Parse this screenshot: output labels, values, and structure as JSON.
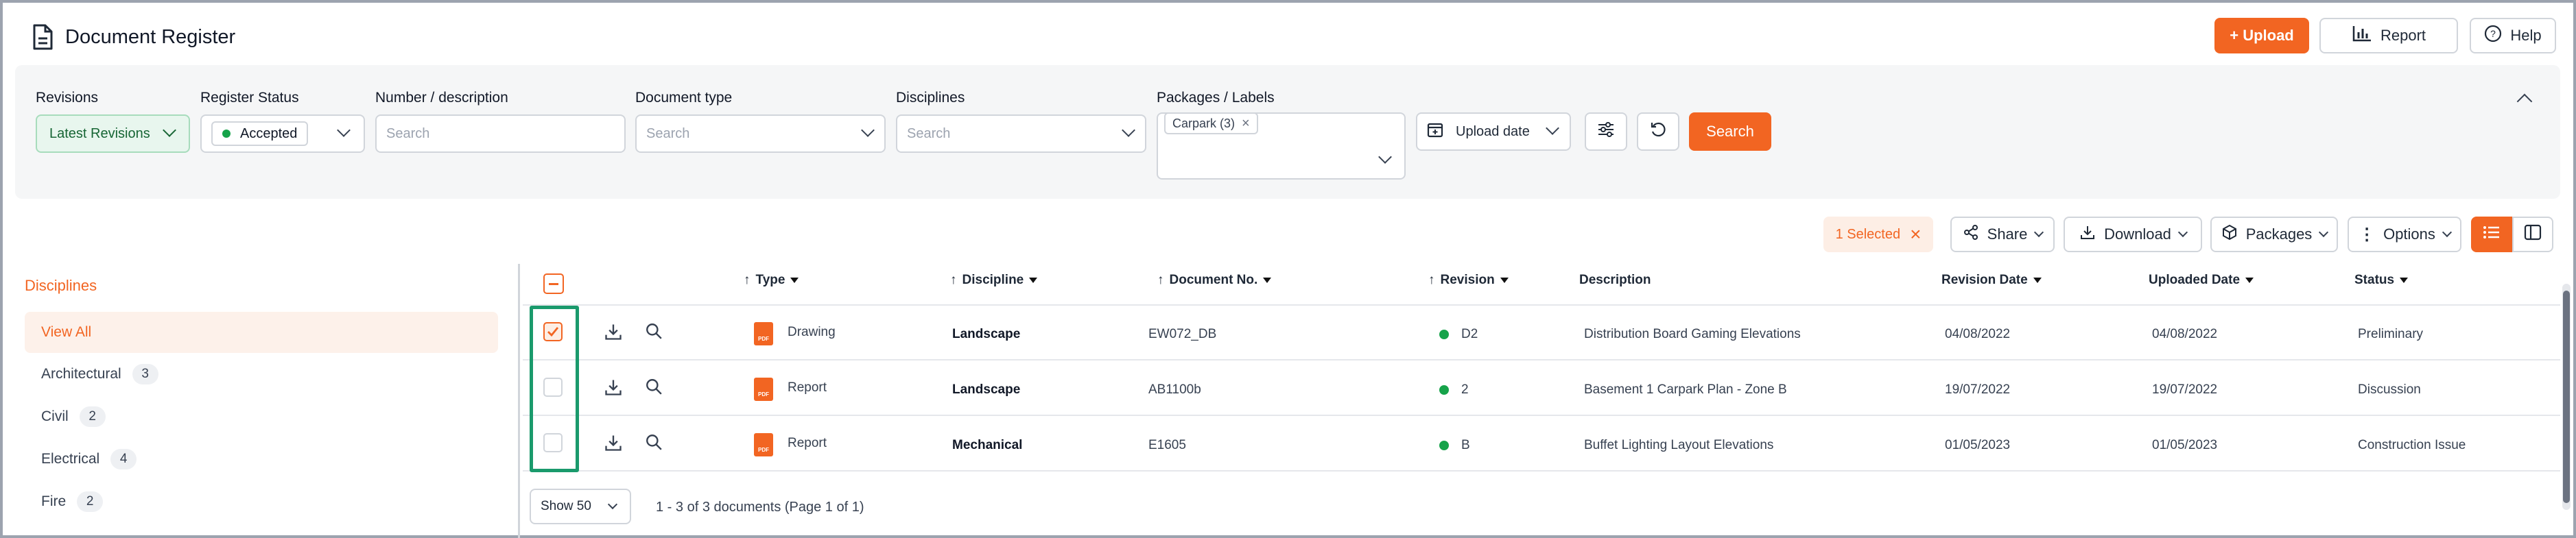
{
  "header": {
    "title": "Document Register"
  },
  "actions": {
    "upload": "+ Upload",
    "report": "Report",
    "help": "Help"
  },
  "filters": {
    "revisions": {
      "label": "Revisions",
      "value": "Latest Revisions"
    },
    "register_status": {
      "label": "Register Status",
      "value": "Accepted"
    },
    "number_description": {
      "label": "Number / description",
      "placeholder": "Search"
    },
    "document_type": {
      "label": "Document type",
      "placeholder": "Search"
    },
    "disciplines": {
      "label": "Disciplines",
      "placeholder": "Search"
    },
    "packages": {
      "label": "Packages / Labels",
      "tag": "Carpark (3)"
    },
    "upload_date": "Upload date",
    "search_button": "Search"
  },
  "toolbar": {
    "selected": "1 Selected",
    "share": "Share",
    "download": "Download",
    "packages": "Packages",
    "options": "Options"
  },
  "sidebar": {
    "title": "Disciplines",
    "items": [
      {
        "label": "View All",
        "count": ""
      },
      {
        "label": "Architectural",
        "count": "3"
      },
      {
        "label": "Civil",
        "count": "2"
      },
      {
        "label": "Electrical",
        "count": "4"
      },
      {
        "label": "Fire",
        "count": "2"
      }
    ]
  },
  "table": {
    "columns": {
      "type": "Type",
      "discipline": "Discipline",
      "doc_no": "Document No.",
      "revision": "Revision",
      "description": "Description",
      "revision_date": "Revision Date",
      "uploaded_date": "Uploaded Date",
      "status": "Status"
    },
    "rows": [
      {
        "type": "Drawing",
        "discipline": "Landscape",
        "doc_no": "EW072_DB",
        "revision": "D2",
        "description": "Distribution Board Gaming Elevations",
        "revision_date": "04/08/2022",
        "uploaded_date": "04/08/2022",
        "status": "Preliminary",
        "checked": true
      },
      {
        "type": "Report",
        "discipline": "Landscape",
        "doc_no": "AB1100b",
        "revision": "2",
        "description": "Basement 1 Carpark Plan - Zone B",
        "revision_date": "19/07/2022",
        "uploaded_date": "19/07/2022",
        "status": "Discussion",
        "checked": false
      },
      {
        "type": "Report",
        "discipline": "Mechanical",
        "doc_no": "E1605",
        "revision": "B",
        "description": "Buffet Lighting Layout Elevations",
        "revision_date": "01/05/2023",
        "uploaded_date": "01/05/2023",
        "status": "Construction Issue",
        "checked": false
      }
    ]
  },
  "pagination": {
    "page_size": "Show 50",
    "summary": "1 - 3 of 3 documents (Page 1 of 1)"
  },
  "colors": {
    "accent": "#f26522",
    "status_dot": "#16a34a",
    "highlight": "#1a9a6c"
  },
  "icons": [
    "document-icon",
    "report-chart-icon",
    "help-icon",
    "calendar-icon",
    "filter-settings-icon",
    "reset-icon",
    "collapse-icon",
    "share-icon",
    "download-icon",
    "package-icon",
    "options-icon",
    "list-view-icon",
    "split-view-icon",
    "search-icon",
    "pdf-icon"
  ]
}
